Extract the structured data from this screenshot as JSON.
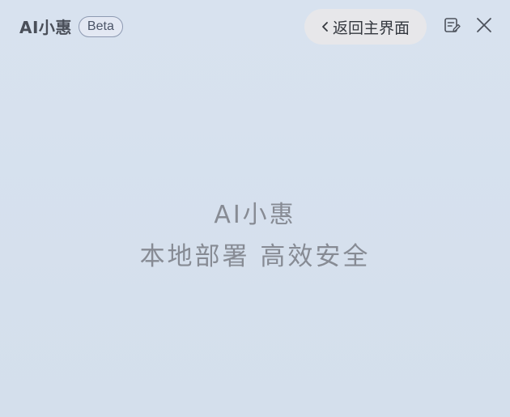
{
  "header": {
    "brand_title": "AI小惠",
    "badge": "Beta",
    "back_button": "返回主界面"
  },
  "icons": {
    "back": "chevron-left-icon",
    "edit": "note-edit-icon",
    "close": "close-icon"
  },
  "main": {
    "title": "AI小惠",
    "subtitle": "本地部署 高效安全"
  },
  "colors": {
    "background": "#d6e0ee",
    "back_button_bg": "#e7e7ea",
    "muted_text": "#878b94"
  }
}
